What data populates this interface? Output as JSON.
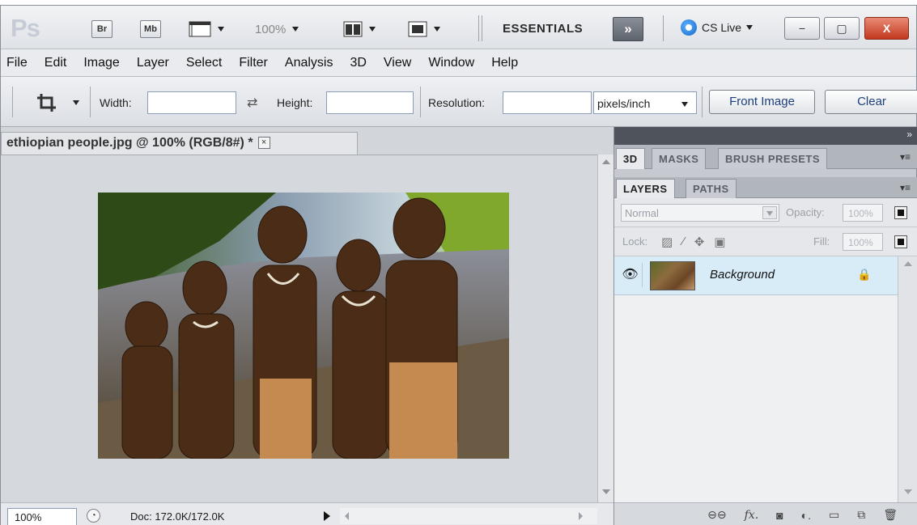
{
  "appbar": {
    "logo": "Ps",
    "bridge_label": "Br",
    "minibridge_label": "Mb",
    "zoom": "100%",
    "workspace": "ESSENTIALS",
    "expand_label": "»",
    "cs_live": "CS Live",
    "window_minimize": "−",
    "window_restore": "▢",
    "window_close": "X"
  },
  "menu": {
    "items": [
      "File",
      "Edit",
      "Image",
      "Layer",
      "Select",
      "Filter",
      "Analysis",
      "3D",
      "View",
      "Window",
      "Help"
    ]
  },
  "options": {
    "width_label": "Width:",
    "width_value": "",
    "height_label": "Height:",
    "height_value": "",
    "resolution_label": "Resolution:",
    "resolution_value": "",
    "units": "pixels/inch",
    "front_image_label": "Front Image",
    "clear_label": "Clear",
    "swap_icon": "⇄"
  },
  "document": {
    "tab_title": "ethiopian people.jpg @ 100% (RGB/8#) *",
    "close_label": "×",
    "zoom": "100%",
    "doc_size": "Doc: 172.0K/172.0K"
  },
  "panels": {
    "top_tabs": [
      "3D",
      "MASKS",
      "BRUSH PRESETS"
    ],
    "layer_tabs": [
      "LAYERS",
      "PATHS"
    ],
    "blend_mode": "Normal",
    "opacity_label": "Opacity:",
    "opacity_value": "100%",
    "lock_label": "Lock:",
    "fill_label": "Fill:",
    "fill_value": "100%",
    "layer_name": "Background"
  },
  "colors": {
    "close_button": "#c2381d",
    "selected_layer": "#d8ecf8"
  }
}
